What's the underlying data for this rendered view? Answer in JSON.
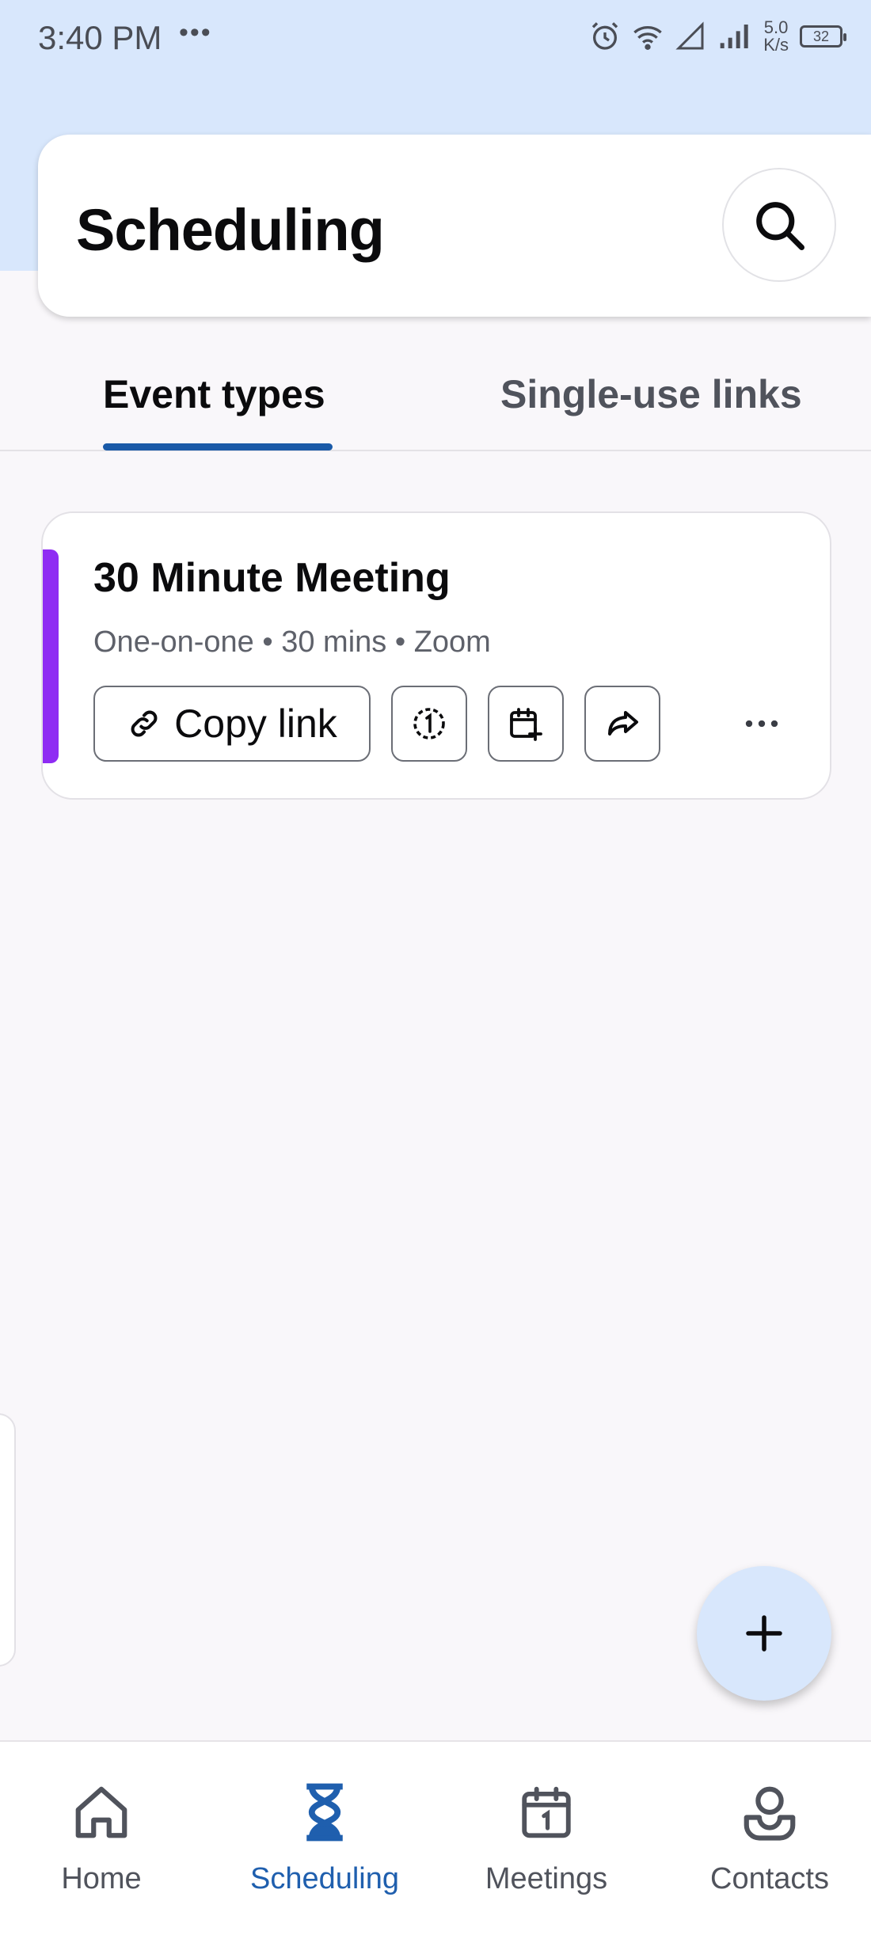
{
  "status_bar": {
    "time": "3:40 PM",
    "dots": "•••",
    "net_speed_value": "5.0",
    "net_speed_unit": "K/s",
    "battery": "32",
    "icons": [
      "alarm-icon",
      "wifi-icon",
      "signal-empty-icon",
      "signal-icon",
      "battery-icon"
    ]
  },
  "header": {
    "title": "Scheduling",
    "search_icon": "search-icon"
  },
  "tabs": [
    {
      "label": "Event types",
      "selected": true
    },
    {
      "label": "Single-use links",
      "selected": false
    }
  ],
  "event_card": {
    "title": "30 Minute Meeting",
    "meta": "One-on-one • 30 mins • Zoom",
    "accent_color": "#8f2cf3",
    "copy_link_label": "Copy link",
    "actions": [
      "one-time-link-icon",
      "add-to-calendar-icon",
      "share-icon",
      "more-options-icon"
    ]
  },
  "fab": {
    "icon": "plus-icon"
  },
  "bottom_nav": [
    {
      "label": "Home",
      "icon": "home-icon",
      "active": false
    },
    {
      "label": "Scheduling",
      "icon": "hourglass-icon",
      "active": true
    },
    {
      "label": "Meetings",
      "icon": "calendar-icon",
      "active": false
    },
    {
      "label": "Contacts",
      "icon": "contacts-icon",
      "active": false
    }
  ],
  "colors": {
    "accent_blue": "#1a5aa8",
    "header_background": "#d8e7fc",
    "page_background": "#f9f7fa"
  }
}
